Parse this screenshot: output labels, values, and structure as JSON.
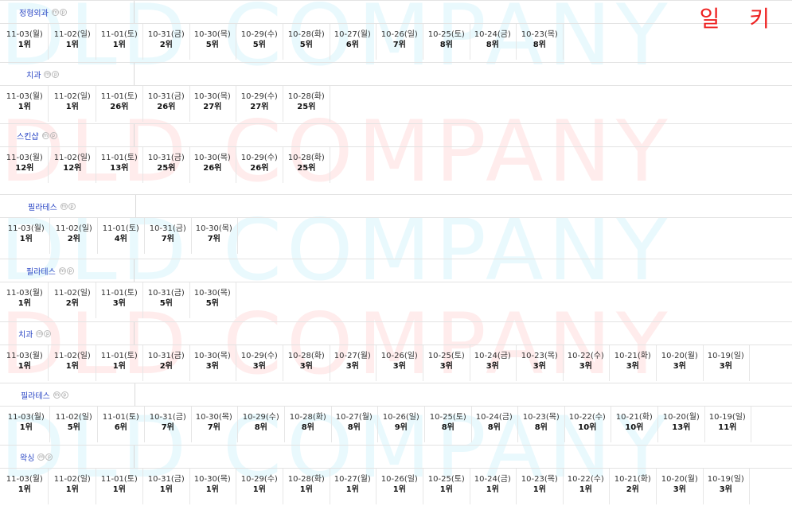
{
  "corner_label": "일 키",
  "watermark": {
    "text": "DLD COMPANY"
  },
  "sections": [
    {
      "title": "정형외과",
      "entries": [
        {
          "date": "11-03(월)",
          "rank": "1위"
        },
        {
          "date": "11-02(일)",
          "rank": "1위"
        },
        {
          "date": "11-01(토)",
          "rank": "1위"
        },
        {
          "date": "10-31(금)",
          "rank": "2위"
        },
        {
          "date": "10-30(목)",
          "rank": "5위"
        },
        {
          "date": "10-29(수)",
          "rank": "5위"
        },
        {
          "date": "10-28(화)",
          "rank": "5위"
        },
        {
          "date": "10-27(월)",
          "rank": "6위"
        },
        {
          "date": "10-26(일)",
          "rank": "7위"
        },
        {
          "date": "10-25(토)",
          "rank": "8위"
        },
        {
          "date": "10-24(금)",
          "rank": "8위"
        },
        {
          "date": "10-23(목)",
          "rank": "8위"
        }
      ]
    },
    {
      "title": "치과",
      "entries": [
        {
          "date": "11-03(월)",
          "rank": "1위"
        },
        {
          "date": "11-02(일)",
          "rank": "1위"
        },
        {
          "date": "11-01(토)",
          "rank": "26위"
        },
        {
          "date": "10-31(금)",
          "rank": "26위"
        },
        {
          "date": "10-30(목)",
          "rank": "27위"
        },
        {
          "date": "10-29(수)",
          "rank": "27위"
        },
        {
          "date": "10-28(화)",
          "rank": "25위"
        }
      ]
    },
    {
      "title": "스킨샵",
      "entries": [
        {
          "date": "11-03(월)",
          "rank": "12위"
        },
        {
          "date": "11-02(일)",
          "rank": "12위"
        },
        {
          "date": "11-01(토)",
          "rank": "13위"
        },
        {
          "date": "10-31(금)",
          "rank": "25위"
        },
        {
          "date": "10-30(목)",
          "rank": "26위"
        },
        {
          "date": "10-29(수)",
          "rank": "26위"
        },
        {
          "date": "10-28(화)",
          "rank": "25위"
        }
      ]
    },
    {
      "title": "필라테스",
      "entries": [
        {
          "date": "11-03(월)",
          "rank": "1위"
        },
        {
          "date": "11-02(일)",
          "rank": "2위"
        },
        {
          "date": "11-01(토)",
          "rank": "4위"
        },
        {
          "date": "10-31(금)",
          "rank": "7위"
        },
        {
          "date": "10-30(목)",
          "rank": "7위"
        }
      ]
    },
    {
      "title": "필라테스",
      "entries": [
        {
          "date": "11-03(월)",
          "rank": "1위"
        },
        {
          "date": "11-02(일)",
          "rank": "2위"
        },
        {
          "date": "11-01(토)",
          "rank": "3위"
        },
        {
          "date": "10-31(금)",
          "rank": "5위"
        },
        {
          "date": "10-30(목)",
          "rank": "5위"
        }
      ]
    },
    {
      "title": "치과",
      "entries": [
        {
          "date": "11-03(월)",
          "rank": "1위"
        },
        {
          "date": "11-02(일)",
          "rank": "1위"
        },
        {
          "date": "11-01(토)",
          "rank": "1위"
        },
        {
          "date": "10-31(금)",
          "rank": "2위"
        },
        {
          "date": "10-30(목)",
          "rank": "3위"
        },
        {
          "date": "10-29(수)",
          "rank": "3위"
        },
        {
          "date": "10-28(화)",
          "rank": "3위"
        },
        {
          "date": "10-27(월)",
          "rank": "3위"
        },
        {
          "date": "10-26(일)",
          "rank": "3위"
        },
        {
          "date": "10-25(토)",
          "rank": "3위"
        },
        {
          "date": "10-24(금)",
          "rank": "3위"
        },
        {
          "date": "10-23(목)",
          "rank": "3위"
        },
        {
          "date": "10-22(수)",
          "rank": "3위"
        },
        {
          "date": "10-21(화)",
          "rank": "3위"
        },
        {
          "date": "10-20(월)",
          "rank": "3위"
        },
        {
          "date": "10-19(일)",
          "rank": "3위"
        }
      ]
    },
    {
      "title": "필라테스",
      "entries": [
        {
          "date": "11-03(월)",
          "rank": "1위"
        },
        {
          "date": "11-02(일)",
          "rank": "5위"
        },
        {
          "date": "11-01(토)",
          "rank": "6위"
        },
        {
          "date": "10-31(금)",
          "rank": "7위"
        },
        {
          "date": "10-30(목)",
          "rank": "7위"
        },
        {
          "date": "10-29(수)",
          "rank": "8위"
        },
        {
          "date": "10-28(화)",
          "rank": "8위"
        },
        {
          "date": "10-27(월)",
          "rank": "8위"
        },
        {
          "date": "10-26(일)",
          "rank": "9위"
        },
        {
          "date": "10-25(토)",
          "rank": "8위"
        },
        {
          "date": "10-24(금)",
          "rank": "8위"
        },
        {
          "date": "10-23(목)",
          "rank": "8위"
        },
        {
          "date": "10-22(수)",
          "rank": "10위"
        },
        {
          "date": "10-21(화)",
          "rank": "10위"
        },
        {
          "date": "10-20(월)",
          "rank": "13위"
        },
        {
          "date": "10-19(일)",
          "rank": "11위"
        }
      ]
    },
    {
      "title": "왁싱",
      "entries": [
        {
          "date": "11-03(월)",
          "rank": "1위"
        },
        {
          "date": "11-02(일)",
          "rank": "1위"
        },
        {
          "date": "11-01(토)",
          "rank": "1위"
        },
        {
          "date": "10-31(금)",
          "rank": "1위"
        },
        {
          "date": "10-30(목)",
          "rank": "1위"
        },
        {
          "date": "10-29(수)",
          "rank": "1위"
        },
        {
          "date": "10-28(화)",
          "rank": "1위"
        },
        {
          "date": "10-27(월)",
          "rank": "1위"
        },
        {
          "date": "10-26(일)",
          "rank": "1위"
        },
        {
          "date": "10-25(토)",
          "rank": "1위"
        },
        {
          "date": "10-24(금)",
          "rank": "1위"
        },
        {
          "date": "10-23(목)",
          "rank": "1위"
        },
        {
          "date": "10-22(수)",
          "rank": "1위"
        },
        {
          "date": "10-21(화)",
          "rank": "2위"
        },
        {
          "date": "10-20(월)",
          "rank": "3위"
        },
        {
          "date": "10-19(일)",
          "rank": "3위"
        }
      ]
    }
  ]
}
